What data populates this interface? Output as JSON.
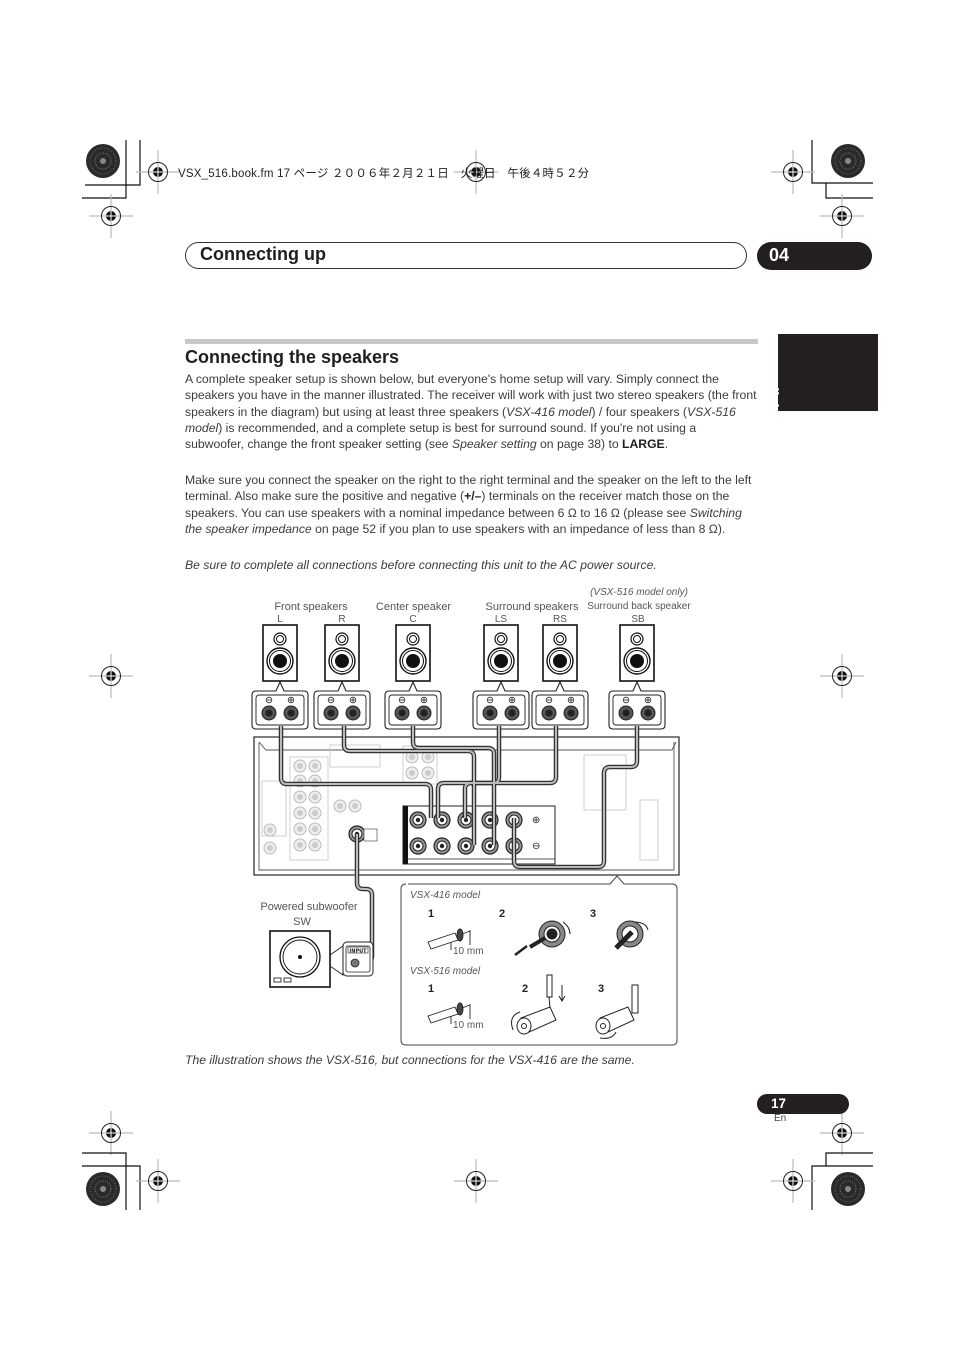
{
  "file_line": "VSX_516.book.fm  17 ページ  ２００６年２月２１日　火曜日　午後４時５２分",
  "chapter": {
    "title": "Connecting up",
    "number": "04"
  },
  "language_tab": "English",
  "section": {
    "title": "Connecting the speakers",
    "p1": {
      "a": "A complete speaker setup is shown below, but everyone's home setup will vary. Simply connect the speakers you have in the manner illustrated. The receiver will work with just two stereo speakers (the front speakers in the diagram) but using at least three speakers (",
      "b": "VSX-416 model",
      "c": ") / four speakers (",
      "d": "VSX-516 model",
      "e": ") is recommended, and a complete setup is best for surround sound. If you're not using a subwoofer, change the front speaker setting (see ",
      "f": "Speaker setting",
      "g": " on page 38) to ",
      "h": "LARGE",
      "i": "."
    },
    "p2": {
      "a": "Make sure you connect the speaker on the right to the right terminal and the speaker on the left to the left terminal. Also make sure the positive and negative (",
      "b": "+/–",
      "c": ") terminals on the receiver match those on the speakers. You can use speakers with a nominal impedance between 6 Ω to 16 Ω (please see ",
      "d": "Switching the speaker impedance",
      "e": " on page 52 if you plan to use speakers with an impedance of less than 8 Ω)."
    },
    "p3": "Be sure to complete all connections before connecting this unit to the AC power source."
  },
  "diagram": {
    "groups": {
      "front": "Front speakers",
      "center": "Center speaker",
      "surround": "Surround speakers",
      "sb_note": "(VSX-516 model only)",
      "surround_back": "Surround back speaker"
    },
    "speakers": [
      {
        "id": "L",
        "label": "L"
      },
      {
        "id": "R",
        "label": "R"
      },
      {
        "id": "C",
        "label": "C"
      },
      {
        "id": "LS",
        "label": "LS"
      },
      {
        "id": "RS",
        "label": "RS"
      },
      {
        "id": "SB",
        "label": "SB"
      }
    ],
    "terminal_symbols": {
      "negative": "⊖",
      "positive": "⊕"
    },
    "subwoofer": {
      "label": "Powered subwoofer",
      "id": "SW",
      "input": "INPUT"
    },
    "inset": {
      "model_416": "VSX-416 model",
      "model_516": "VSX-516 model",
      "steps": [
        "1",
        "2",
        "3"
      ],
      "strip_length": "10 mm"
    }
  },
  "caption": "The illustration shows the VSX-516, but connections for the VSX-416 are the same.",
  "page": {
    "number": "17",
    "lang": "En"
  }
}
